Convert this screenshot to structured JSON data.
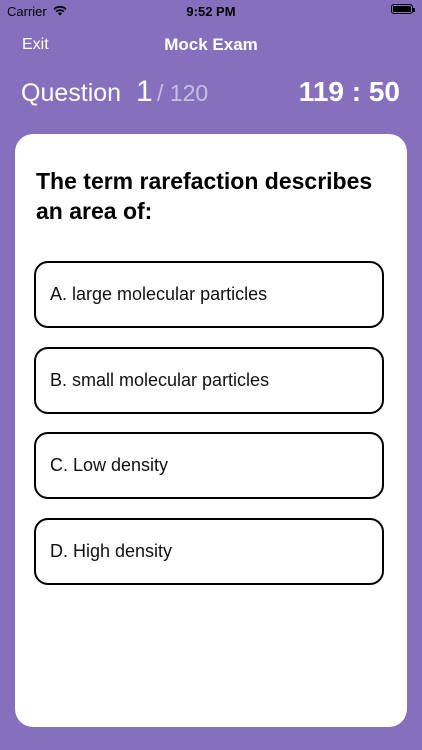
{
  "status_bar": {
    "carrier": "Carrier",
    "time": "9:52 PM",
    "wifi_icon": "wifi-icon",
    "battery_icon": "battery-icon",
    "battery_level": 1.0
  },
  "nav": {
    "exit_label": "Exit",
    "title": "Mock Exam"
  },
  "question_header": {
    "label": "Question",
    "current": "1",
    "total": "/ 120",
    "timer": "119 : 50"
  },
  "question": {
    "text": "The term rarefaction describes an area of:",
    "options": [
      {
        "label": "A. large molecular particles"
      },
      {
        "label": "B. small molecular particles"
      },
      {
        "label": "C. Low density"
      },
      {
        "label": "D. High density"
      }
    ]
  },
  "colors": {
    "background": "#8670bd",
    "card": "#ffffff",
    "text_dark": "#000000"
  }
}
